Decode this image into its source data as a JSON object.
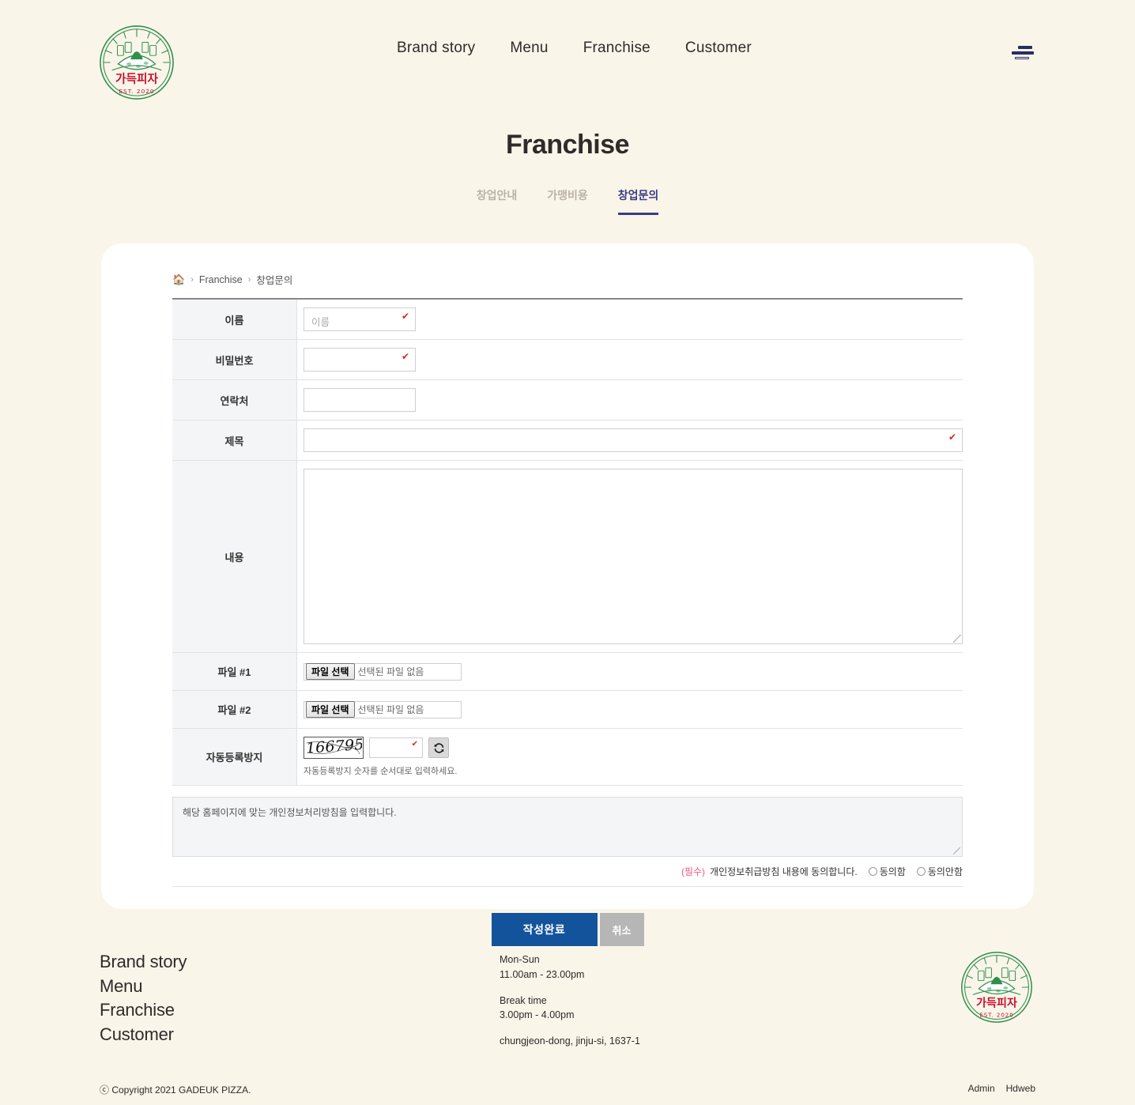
{
  "site": {
    "logo_alt": "가득피자",
    "logo_text": "가득피자",
    "logo_est": "EST. 2020"
  },
  "header": {
    "nav": [
      {
        "label": "Brand story"
      },
      {
        "label": "Menu"
      },
      {
        "label": "Franchise"
      },
      {
        "label": "Customer"
      }
    ],
    "menu_icon": "hamburger-icon"
  },
  "page": {
    "title": "Franchise",
    "tabs": [
      {
        "label": "창업안내",
        "active": false
      },
      {
        "label": "가맹비용",
        "active": false
      },
      {
        "label": "창업문의",
        "active": true
      }
    ]
  },
  "breadcrumb": {
    "home_icon": "home-icon",
    "separator": "›",
    "items": [
      "Franchise",
      "창업문의"
    ]
  },
  "form": {
    "rows": {
      "name": {
        "label": "이름",
        "placeholder": "이름",
        "value": "",
        "required_mark": "✔"
      },
      "password": {
        "label": "비밀번호",
        "placeholder": "",
        "value": "",
        "required_mark": "✔"
      },
      "contact": {
        "label": "연락처",
        "placeholder": "",
        "value": ""
      },
      "subject": {
        "label": "제목",
        "placeholder": "",
        "value": "",
        "required_mark": "✔"
      },
      "content": {
        "label": "내용",
        "value": ""
      },
      "file1": {
        "label": "파일 #1",
        "button": "파일 선택",
        "status": "선택된 파일 없음"
      },
      "file2": {
        "label": "파일 #2",
        "button": "파일 선택",
        "status": "선택된 파일 없음"
      },
      "captcha": {
        "label": "자동등록방지",
        "image_text": "166795",
        "value": "",
        "required_mark": "✔",
        "refresh_icon": "refresh-icon",
        "hint": "자동등록방지 숫자를 순서대로 입력하세요."
      }
    }
  },
  "privacy": {
    "policy_text": "해당 홈페이지에 맞는 개인정보처리방침을 입력합니다.",
    "required_tag": "(필수)",
    "agree_text": "개인정보취급방침 내용에 동의합니다.",
    "options": [
      "동의함",
      "동의안함"
    ]
  },
  "actions": {
    "submit": "작성완료",
    "cancel": "취소"
  },
  "footer": {
    "links": [
      "Brand story",
      "Menu",
      "Franchise",
      "Customer"
    ],
    "hours_label": "Mon-Sun",
    "hours_value": "11.00am - 23.00pm",
    "break_label": "Break time",
    "break_value": "3.00pm - 4.00pm",
    "address": "chungjeon-dong, jinju-si, 1637-1",
    "copyright": "ⓒ Copyright 2021 GADEUK PIZZA.",
    "right_links": [
      "Admin",
      "Hdweb"
    ]
  },
  "colors": {
    "background": "#faf5e9",
    "card": "#ffffff",
    "accent": "#3b3b86",
    "primary_button": "#13539c",
    "cancel_button": "#b6b6b6",
    "required_red": "#d42b1e",
    "required_pink": "#e8607f",
    "logo_green": "#2f8f4e",
    "logo_red": "#c8102e"
  }
}
